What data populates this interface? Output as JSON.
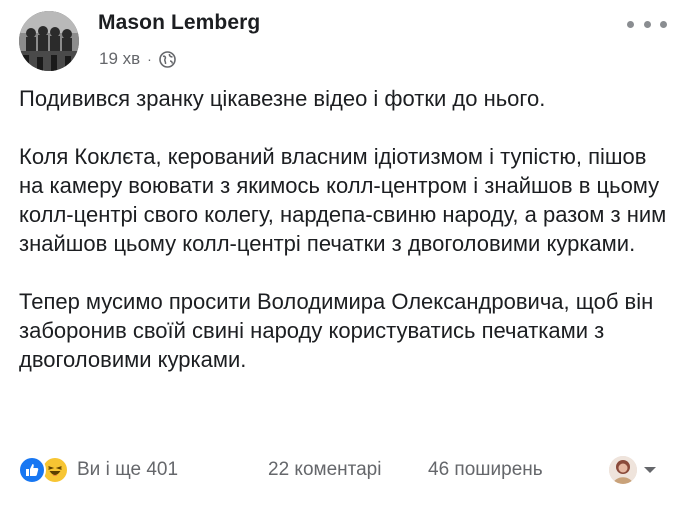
{
  "post": {
    "author": "Mason Lemberg",
    "time": "19 хв",
    "separator": "·",
    "privacy_icon": "globe-icon",
    "more_icon": "more-dots-icon",
    "paragraphs": [
      "Подивився зранку цікавезне відео і фотки до нього.",
      "Коля Коклєта, керований власним ідіотизмом і тупістю, пішов на камеру воювати з якимось колл-центром і знайшов в цьому колл-центрі свого колегу, нардепа-свиню народу, а разом з ним знайшов цьому колл-центрі печатки з двоголовими курками.",
      "Тепер мусимо просити Володимира Олександровича, щоб він заборонив своїй свині народу користуватись печатками з двоголовими курками."
    ]
  },
  "footer": {
    "reactions_label": "Ви і ще 401",
    "reaction_icons": [
      "like-icon",
      "haha-icon"
    ],
    "comments": "22 коментарі",
    "shares": "46 поширень",
    "viewer_caret_icon": "caret-down-icon"
  },
  "colors": {
    "text": "#1c1e21",
    "secondary": "#65676b",
    "like": "#1877f2",
    "haha": "#f7c533"
  }
}
